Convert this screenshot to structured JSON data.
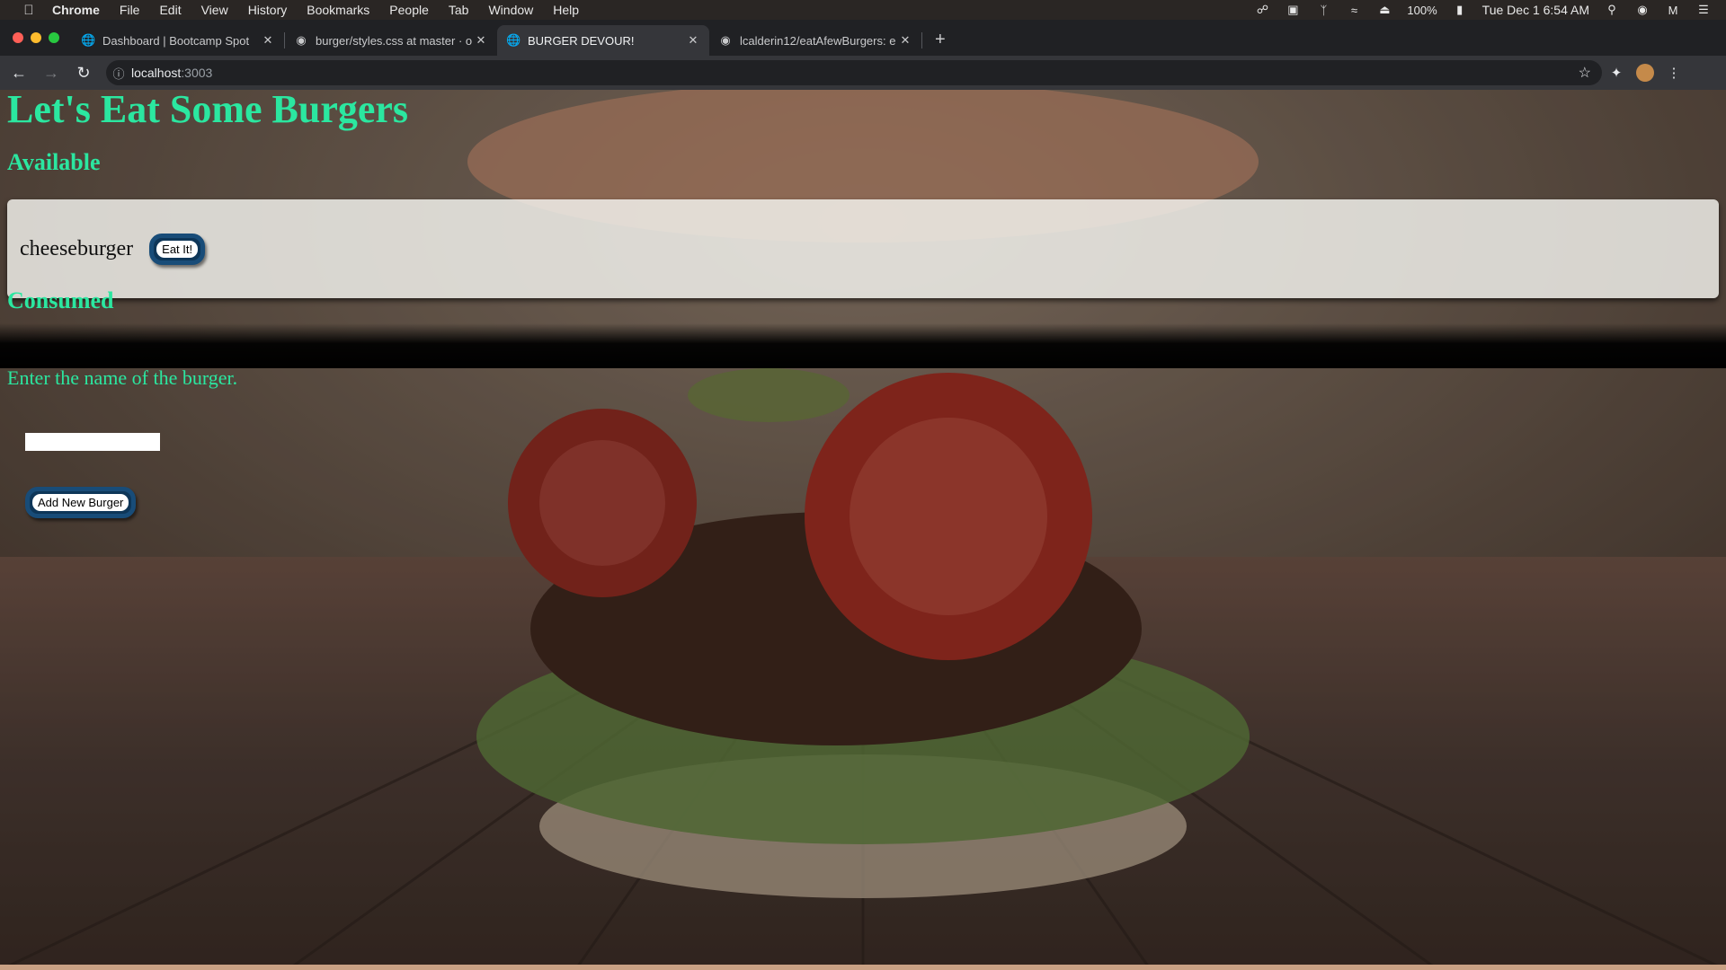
{
  "menubar": {
    "app": "Chrome",
    "items": [
      "File",
      "Edit",
      "View",
      "History",
      "Bookmarks",
      "People",
      "Tab",
      "Window",
      "Help"
    ],
    "battery": "100%",
    "clock": "Tue Dec 1  6:54 AM"
  },
  "tabs": [
    {
      "title": "Dashboard | Bootcamp Spot",
      "icon": "globe-icon"
    },
    {
      "title": "burger/styles.css at master · o",
      "icon": "github-icon"
    },
    {
      "title": "BURGER DEVOUR!",
      "icon": "globe-icon",
      "active": true
    },
    {
      "title": "lcalderin12/eatAfewBurgers: e",
      "icon": "github-icon"
    }
  ],
  "address": {
    "host": "localhost",
    "port": ":3003"
  },
  "page": {
    "title": "Let's Eat Some Burgers",
    "available_heading": "Available",
    "available_burgers": [
      {
        "name": "cheeseburger",
        "button": "Eat It!"
      }
    ],
    "consumed_heading": "Consumed",
    "form_prompt": "Enter the name of the burger.",
    "input_value": "",
    "add_button": "Add New Burger"
  },
  "colors": {
    "heading_green": "#2be7a0",
    "button_blue": "#0e3658"
  }
}
